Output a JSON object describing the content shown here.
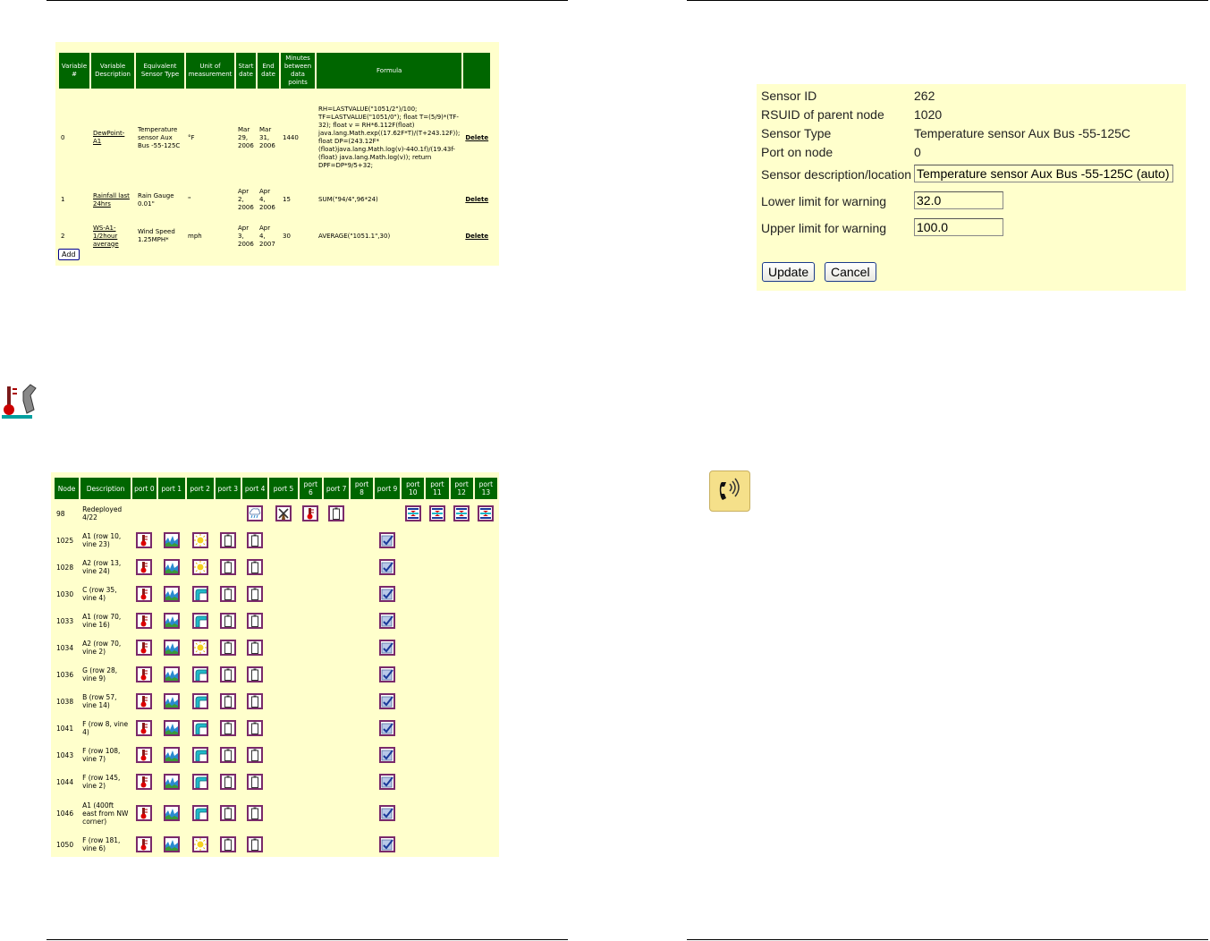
{
  "variables_table": {
    "headers": [
      "Variable #",
      "Variable Description",
      "Equivalent Sensor Type",
      "Unit of measurement",
      "Start date",
      "End date",
      "Minutes between data points",
      "Formula",
      ""
    ],
    "rows": [
      {
        "num": "0",
        "desc": "DewPoint-A1",
        "sensor": "Temperature sensor Aux Bus -55-125C",
        "unit": "°F",
        "start": "Mar 29, 2006",
        "end": "Mar 31, 2006",
        "minutes": "1440",
        "formula": "RH=LASTVALUE(\"1051/2\")/100; TF=LASTVALUE(\"1051/0\"); float T=(5/9)*(TF-32); float v = RH*6.112F(float) java.lang.Math.exp((17.62F*T)/(T+243.12F)); float DP=(243.12F* (float)java.lang.Math.log(v)-440.1f)/(19.43f-(float) java.lang.Math.log(v)); return DPF=DP*9/5+32;",
        "action": "Delete"
      },
      {
        "num": "1",
        "desc": "Rainfall last 24hrs",
        "sensor": "Rain Gauge 0.01\"",
        "unit": "\"",
        "start": "Apr 2, 2006",
        "end": "Apr 4, 2006",
        "minutes": "15",
        "formula": "SUM(\"94/4\",96*24)",
        "action": "Delete"
      },
      {
        "num": "2",
        "desc": "WS-A1-1/2hour average",
        "sensor": "Wind Speed 1.25MPH*",
        "unit": "mph",
        "start": "Apr 3, 2006",
        "end": "Apr 4, 2007",
        "minutes": "30",
        "formula": "AVERAGE(\"1051.1\",30)",
        "action": "Delete"
      }
    ],
    "add_label": "Add"
  },
  "nodes_table": {
    "headers": [
      "Node",
      "Description",
      "port 0",
      "port 1",
      "port 2",
      "port 3",
      "port 4",
      "port 5",
      "port 6",
      "port 7",
      "port 8",
      "port 9",
      "port 10",
      "port 11",
      "port 12",
      "port 13"
    ],
    "rows": [
      {
        "node": "98",
        "desc": "Redeployed 4/22",
        "icons": [
          "",
          "",
          "",
          "",
          "rain-icon",
          "windmill-icon",
          "thermometer-icon",
          "battery-icon",
          "",
          "",
          "level-icon",
          "level-icon",
          "level-icon",
          "level-icon"
        ]
      },
      {
        "node": "1025",
        "desc": "A1 (row 10, vine 23)",
        "icons": [
          "thermometer-icon",
          "water-icon",
          "sun-icon",
          "battery-icon",
          "battery-icon",
          "",
          "",
          "",
          "",
          "calibrate-icon",
          "",
          "",
          "",
          ""
        ]
      },
      {
        "node": "1028",
        "desc": "A2 (row 13, vine 24)",
        "icons": [
          "thermometer-icon",
          "water-icon",
          "sun-icon",
          "battery-icon",
          "battery-icon",
          "",
          "",
          "",
          "",
          "calibrate-icon",
          "",
          "",
          "",
          ""
        ]
      },
      {
        "node": "1030",
        "desc": "C (row 35, vine 4)",
        "icons": [
          "thermometer-icon",
          "water-icon",
          "pipe-icon",
          "battery-icon",
          "battery-icon",
          "",
          "",
          "",
          "",
          "calibrate-icon",
          "",
          "",
          "",
          ""
        ]
      },
      {
        "node": "1033",
        "desc": "A1 (row 70, vine 16)",
        "icons": [
          "thermometer-icon",
          "water-icon",
          "pipe-icon",
          "battery-icon",
          "battery-icon",
          "",
          "",
          "",
          "",
          "calibrate-icon",
          "",
          "",
          "",
          ""
        ]
      },
      {
        "node": "1034",
        "desc": "A2 (row 70, vine 2)",
        "icons": [
          "thermometer-icon",
          "water-icon",
          "sun-icon",
          "battery-icon",
          "battery-icon",
          "",
          "",
          "",
          "",
          "calibrate-icon",
          "",
          "",
          "",
          ""
        ]
      },
      {
        "node": "1036",
        "desc": "G (row 28, vine 9)",
        "icons": [
          "thermometer-icon",
          "water-icon",
          "pipe-icon",
          "battery-icon",
          "battery-icon",
          "",
          "",
          "",
          "",
          "calibrate-icon",
          "",
          "",
          "",
          ""
        ]
      },
      {
        "node": "1038",
        "desc": "B (row 57, vine 14)",
        "icons": [
          "thermometer-icon",
          "water-icon",
          "pipe-icon",
          "battery-icon",
          "battery-icon",
          "",
          "",
          "",
          "",
          "calibrate-icon",
          "",
          "",
          "",
          ""
        ]
      },
      {
        "node": "1041",
        "desc": "F (row 8, vine 4)",
        "icons": [
          "thermometer-icon",
          "water-icon",
          "pipe-icon",
          "battery-icon",
          "battery-icon",
          "",
          "",
          "",
          "",
          "calibrate-icon",
          "",
          "",
          "",
          ""
        ]
      },
      {
        "node": "1043",
        "desc": "F (row 108, vine 7)",
        "icons": [
          "thermometer-icon",
          "water-icon",
          "pipe-icon",
          "battery-icon",
          "battery-icon",
          "",
          "",
          "",
          "",
          "calibrate-icon",
          "",
          "",
          "",
          ""
        ]
      },
      {
        "node": "1044",
        "desc": "F (row 145, vine 2)",
        "icons": [
          "thermometer-icon",
          "water-icon",
          "pipe-icon",
          "battery-icon",
          "battery-icon",
          "",
          "",
          "",
          "",
          "calibrate-icon",
          "",
          "",
          "",
          ""
        ]
      },
      {
        "node": "1046",
        "desc": "A1 (400ft east from NW corner)",
        "icons": [
          "thermometer-icon",
          "water-icon",
          "pipe-icon",
          "battery-icon",
          "battery-icon",
          "",
          "",
          "",
          "",
          "calibrate-icon",
          "",
          "",
          "",
          ""
        ]
      },
      {
        "node": "1050",
        "desc": "F (row 181, vine 6)",
        "icons": [
          "thermometer-icon",
          "water-icon",
          "sun-icon",
          "battery-icon",
          "battery-icon",
          "",
          "",
          "",
          "",
          "calibrate-icon",
          "",
          "",
          "",
          ""
        ]
      }
    ]
  },
  "sensor_form": {
    "fields": [
      {
        "label": "Sensor ID",
        "value": "262"
      },
      {
        "label": "RSUID of parent node",
        "value": "1020"
      },
      {
        "label": "Sensor Type",
        "value": "Temperature sensor Aux Bus -55-125C"
      },
      {
        "label": "Port on node",
        "value": "0"
      }
    ],
    "description_label": "Sensor description/location",
    "description_value": "Temperature sensor Aux Bus -55-125C (auto)",
    "lower_label": "Lower limit for warning",
    "lower_value": "32.0",
    "upper_label": "Upper limit for warning",
    "upper_value": "100.0",
    "update_label": "Update",
    "cancel_label": "Cancel"
  }
}
